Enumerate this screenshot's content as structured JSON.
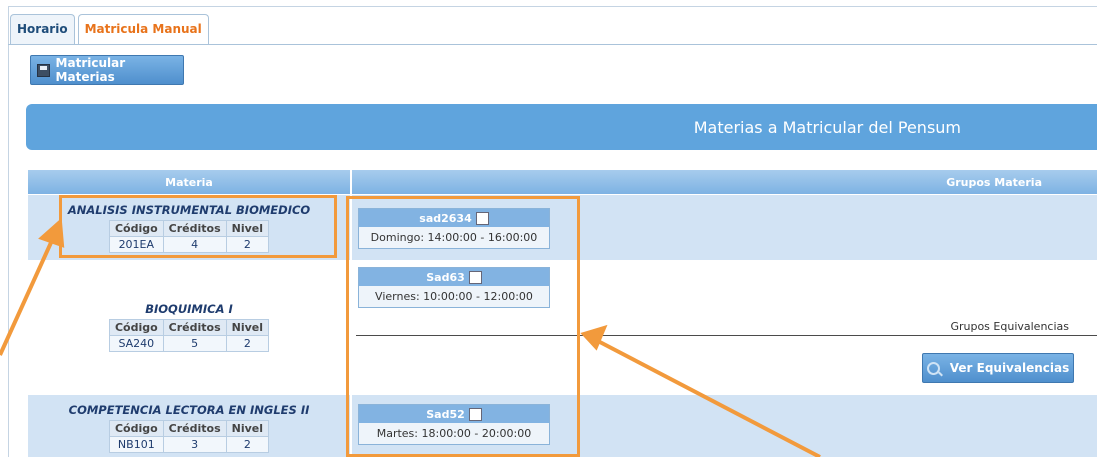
{
  "tabs": [
    {
      "label": "Horario"
    },
    {
      "label": "Matricula Manual"
    }
  ],
  "toolbar": {
    "matricular_label": "Matricular Materias"
  },
  "title": "Materias a Matricular del Pensum",
  "table_headers": {
    "materia": "Materia",
    "grupos": "Grupos Materia"
  },
  "info_headers": {
    "codigo": "Código",
    "creditos": "Créditos",
    "nivel": "Nivel"
  },
  "courses": [
    {
      "name": "ANALISIS INSTRUMENTAL BIOMEDICO",
      "codigo": "201EA",
      "creditos": "4",
      "nivel": "2",
      "group": {
        "name": "sad2634",
        "schedule": "Domingo: 14:00:00 - 16:00:00"
      }
    },
    {
      "name": "BIOQUIMICA I",
      "codigo": "SA240",
      "creditos": "5",
      "nivel": "2",
      "group": {
        "name": "Sad63",
        "schedule": "Viernes: 10:00:00 - 12:00:00"
      }
    },
    {
      "name": "COMPETENCIA LECTORA EN INGLES II",
      "codigo": "NB101",
      "creditos": "3",
      "nivel": "2",
      "group": {
        "name": "Sad52",
        "schedule": "Martes: 18:00:00 - 20:00:00"
      }
    }
  ],
  "equivalencias": {
    "label": "Grupos Equivalencias",
    "button_label": "Ver Equivalencias"
  },
  "colors": {
    "accent": "#5fa4dd",
    "annotation": "#f29a3c",
    "tab_active": "#e8731b"
  }
}
